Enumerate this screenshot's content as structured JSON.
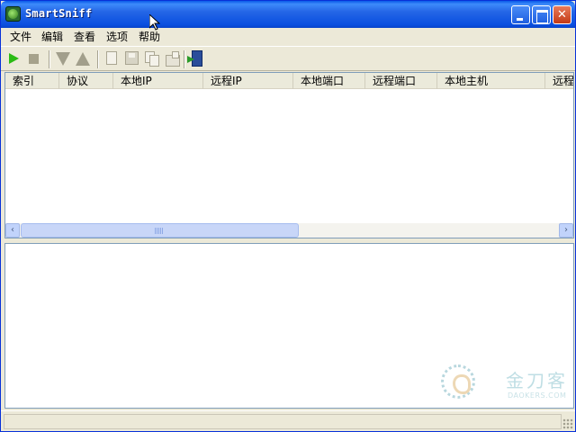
{
  "window": {
    "title": "SmartSniff",
    "icon": "smartsniff-app-icon",
    "controls": [
      "minimize-icon",
      "maximize-icon",
      "close-icon"
    ]
  },
  "menu": {
    "items": [
      {
        "label": "文件"
      },
      {
        "label": "编辑"
      },
      {
        "label": "查看"
      },
      {
        "label": "选项"
      },
      {
        "label": "帮助"
      }
    ]
  },
  "toolbar": {
    "buttons": [
      {
        "name": "start-capture",
        "icon": "play-icon",
        "enabled": true
      },
      {
        "name": "stop-capture",
        "icon": "stop-icon",
        "enabled": false
      },
      {
        "name": "next",
        "icon": "arrow-down-icon",
        "enabled": false
      },
      {
        "name": "previous",
        "icon": "arrow-up-icon",
        "enabled": false
      },
      {
        "name": "new",
        "icon": "document-icon",
        "enabled": false
      },
      {
        "name": "save",
        "icon": "save-icon",
        "enabled": false
      },
      {
        "name": "copy",
        "icon": "copy-icon",
        "enabled": false
      },
      {
        "name": "properties",
        "icon": "properties-icon",
        "enabled": false
      },
      {
        "name": "exit",
        "icon": "exit-icon",
        "enabled": true
      }
    ]
  },
  "list": {
    "columns": [
      "索引",
      "协议",
      "本地IP",
      "远程IP",
      "本地端口",
      "远程端口",
      "本地主机",
      "远程"
    ],
    "rows": []
  },
  "watermark": {
    "text": "金刀客",
    "subtext": "DAOKERS.COM"
  },
  "status": {
    "text": ""
  },
  "colors": {
    "titlebar": "#0a4fe0",
    "chrome": "#ece9d8",
    "border": "#7f9db9",
    "play": "#2bbb14"
  }
}
